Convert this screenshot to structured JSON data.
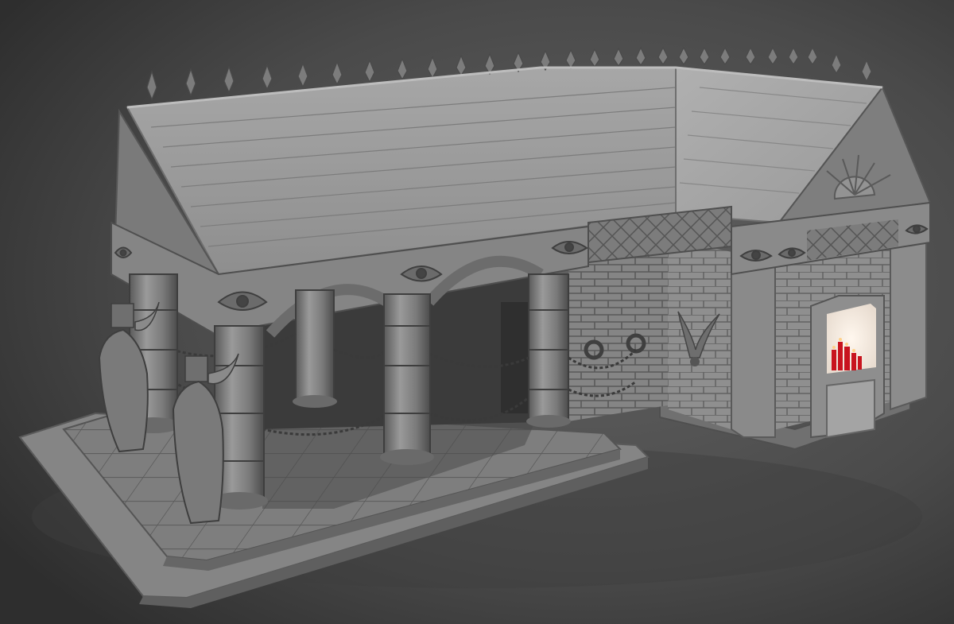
{
  "scene": {
    "subject": "temple-sculpt-render",
    "colors": {
      "background_light": "#5d5d5d",
      "background_dark": "#2e2e2e",
      "stone_light": "#a9a9a9",
      "stone_mid": "#8a8a8a",
      "stone_dark": "#5e5e5e",
      "shadow": "#3a3a3a",
      "fire": "#c8141e",
      "fire_glow": "#fff4e8"
    }
  }
}
